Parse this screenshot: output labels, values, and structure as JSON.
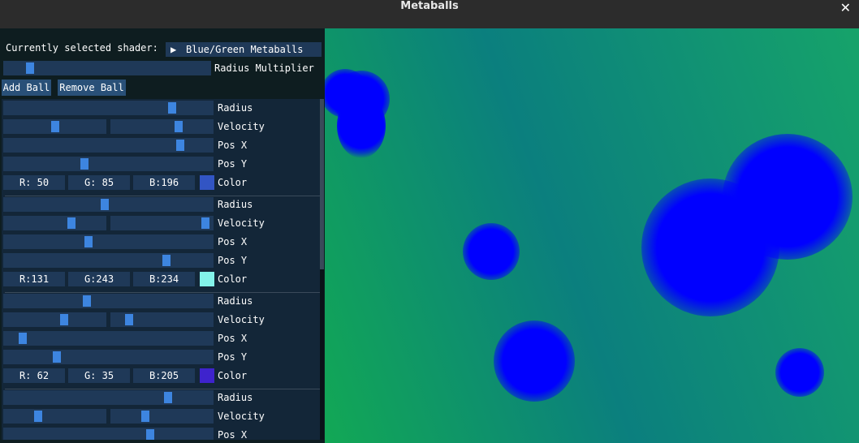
{
  "window": {
    "title": "Metaballs",
    "close_glyph": "✕"
  },
  "panel": {
    "shader_label": "Currently selected shader:",
    "shader_arrow": "▶",
    "shader_value": "Blue/Green Metaballs",
    "radius_multiplier_label": "Radius Multiplier",
    "radius_multiplier_value": 0.05,
    "add_ball_label": "Add Ball",
    "remove_ball_label": "Remove Ball"
  },
  "balls": [
    {
      "radius_label": "Radius",
      "radius_value": 0.82,
      "velocity_label": "Velocity",
      "velocity_x": 0.5,
      "velocity_y": 0.68,
      "posx_label": "Pos X",
      "posx_value": 0.86,
      "posy_label": "Pos Y",
      "posy_value": 0.38,
      "r_text": "R: 50",
      "g_text": "G: 85",
      "b_text": "B:196",
      "color_label": "Color",
      "color_hex": "#3255c4"
    },
    {
      "radius_label": "Radius",
      "radius_value": 0.48,
      "velocity_label": "Velocity",
      "velocity_x": 0.68,
      "velocity_y": 0.97,
      "posx_label": "Pos X",
      "posx_value": 0.4,
      "posy_label": "Pos Y",
      "posy_value": 0.79,
      "r_text": "R:131",
      "g_text": "G:243",
      "b_text": "B:234",
      "color_label": "Color",
      "color_hex": "#83f3ea"
    },
    {
      "radius_label": "Radius",
      "radius_value": 0.39,
      "velocity_label": "Velocity",
      "velocity_x": 0.6,
      "velocity_y": 0.14,
      "posx_label": "Pos X",
      "posx_value": 0.07,
      "posy_label": "Pos Y",
      "posy_value": 0.24,
      "r_text": "R: 62",
      "g_text": "G: 35",
      "b_text": "B:205",
      "color_label": "Color",
      "color_hex": "#3e23cd"
    },
    {
      "radius_label": "Radius",
      "radius_value": 0.8,
      "velocity_label": "Velocity",
      "velocity_x": 0.32,
      "velocity_y": 0.32,
      "posx_label": "Pos X",
      "posx_value": 0.71
    }
  ],
  "colors": {
    "blob": "#0000ff",
    "bg_green": "#12a855",
    "bg_teal": "#0b7f7e"
  }
}
